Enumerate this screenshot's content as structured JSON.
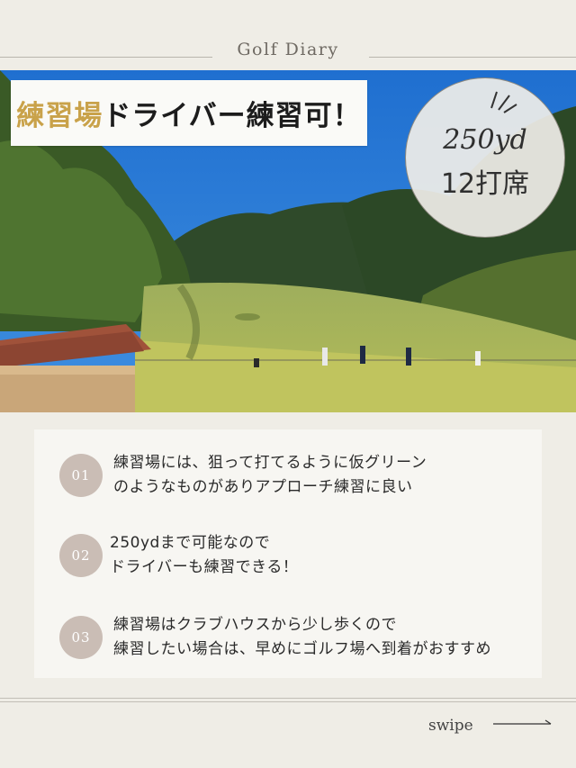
{
  "header": {
    "title": "Golf Diary"
  },
  "banner": {
    "highlight": "練習場",
    "rest": "ドライバー練習可！"
  },
  "badge": {
    "distance": "250yd",
    "seats": "12打席"
  },
  "points": [
    {
      "num": "01",
      "line1": "練習場には、狙って打てるように仮グリーン",
      "line2": "のようなものがありアプローチ練習に良い"
    },
    {
      "num": "02",
      "line1": "250ydまで可能なので",
      "line2": "ドライバーも練習できる！"
    },
    {
      "num": "03",
      "line1": "練習場はクラブハウスから少し歩くので",
      "line2": "練習したい場合は、早めにゴルフ場へ到着がおすすめ"
    }
  ],
  "footer": {
    "swipe": "swipe"
  },
  "colors": {
    "background": "#efede6",
    "accent_gold": "#c9a24a",
    "number_circle": "#cabdb5"
  }
}
